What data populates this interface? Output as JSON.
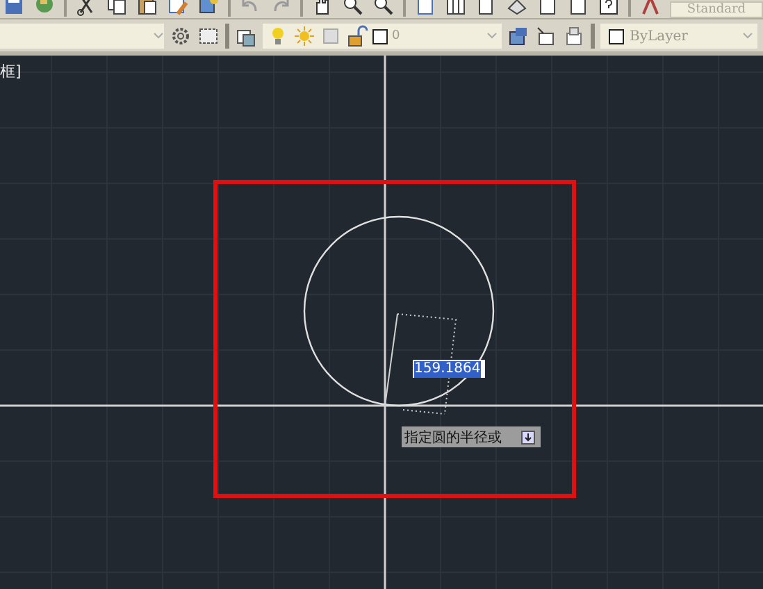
{
  "toolbar_top": {
    "text_style": "Standard"
  },
  "toolbar_layers": {
    "layer": "0",
    "color_control": "ByLayer"
  },
  "viewport_label": "框]",
  "dynamic_input": {
    "value": "159.1864"
  },
  "command_prompt": {
    "text": "指定圆的半径或"
  }
}
